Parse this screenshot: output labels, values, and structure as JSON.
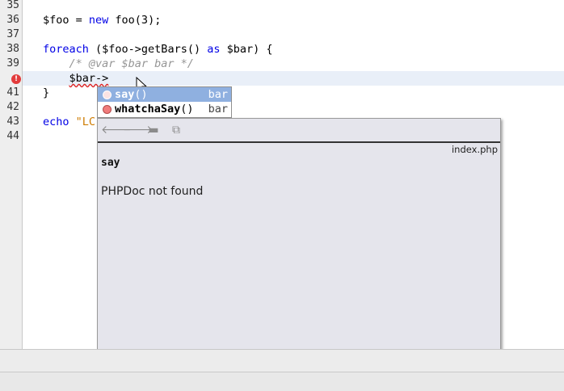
{
  "line_numbers": [
    "35",
    "36",
    "37",
    "38",
    "39",
    "",
    "41",
    "42",
    "43",
    "44"
  ],
  "error_marker": "!",
  "code": {
    "l36_var": "$foo",
    "l36_eq": " = ",
    "l36_new": "new",
    "l36_rest": " foo(3);",
    "l38_foreach": "foreach",
    "l38_mid": " ($foo->getBars() ",
    "l38_as": "as",
    "l38_rest": " $bar) {",
    "l39_comment": "    /* @var $bar bar */",
    "l40_indent": "    ",
    "l40_text": "$bar->",
    "l41_brace": "}",
    "l43_echo": "echo",
    "l43_sp": " ",
    "l43_str": "\"LC"
  },
  "completion": {
    "items": [
      {
        "name": "say",
        "params": "()",
        "type": "bar"
      },
      {
        "name": "whatchaSay",
        "params": "()",
        "type": "bar"
      }
    ]
  },
  "doc": {
    "file": "index.php",
    "name": "say",
    "message": "PHPDoc not found",
    "toolbar": {
      "back": "🡐",
      "forward": "🡒",
      "source": "▬",
      "browser": "⧉"
    }
  },
  "colors": {
    "keyword": "#0000e6",
    "comment": "#969696",
    "string": "#ce7b00",
    "selection": "#8fb0e0"
  }
}
